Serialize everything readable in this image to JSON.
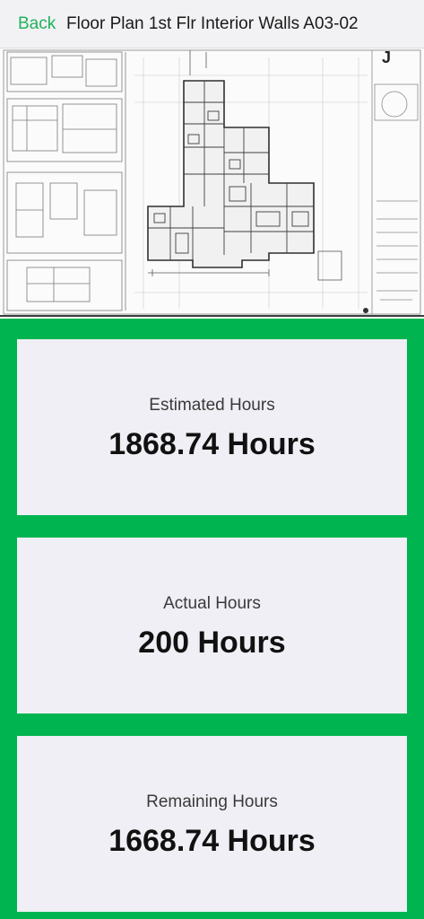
{
  "navbar": {
    "back_label": "Back",
    "title": "Floor Plan 1st Flr Interior Walls A03-02"
  },
  "drawing": {
    "logo_text": "J"
  },
  "stats": [
    {
      "label": "Estimated Hours",
      "value": "1868.74 Hours"
    },
    {
      "label": "Actual Hours",
      "value": "200 Hours"
    },
    {
      "label": "Remaining Hours",
      "value": "1668.74 Hours"
    }
  ],
  "colors": {
    "accent_green": "#00b550",
    "back_link": "#20b25a",
    "card_bg": "#f0eff5"
  }
}
